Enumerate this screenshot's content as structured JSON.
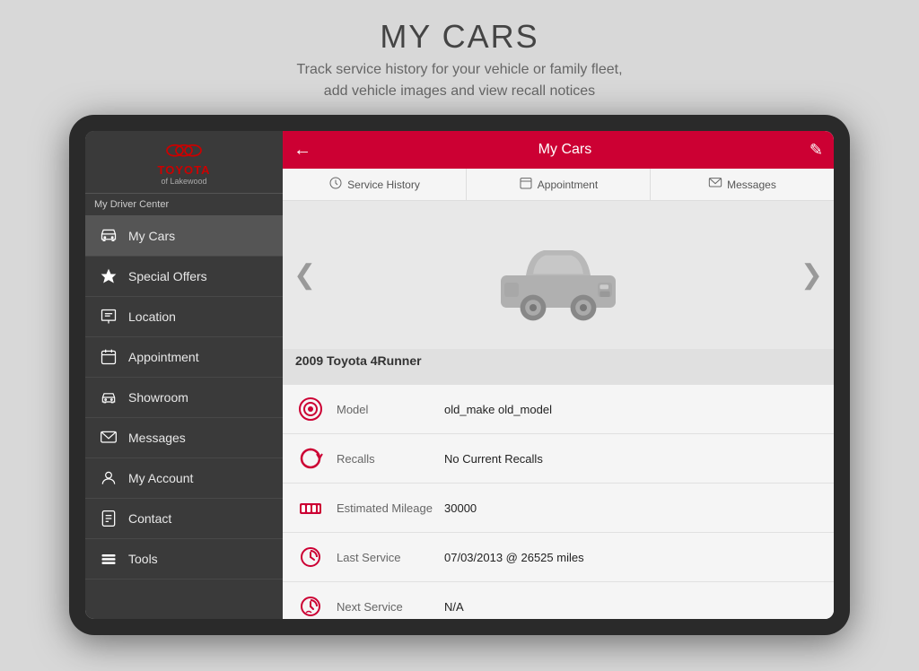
{
  "header": {
    "title": "MY CARS",
    "subtitle_line1": "Track service history for your vehicle or family fleet,",
    "subtitle_line2": "add vehicle images and view recall notices"
  },
  "sidebar": {
    "logo_text": "TOYOTA",
    "logo_sub": "of Lakewood",
    "driver_center": "My Driver Center",
    "items": [
      {
        "id": "my-cars",
        "label": "My Cars",
        "icon": "🏠",
        "active": true
      },
      {
        "id": "special-offers",
        "label": "Special Offers",
        "icon": "⭐",
        "active": false
      },
      {
        "id": "location",
        "label": "Location",
        "icon": "🗺",
        "active": false
      },
      {
        "id": "appointment",
        "label": "Appointment",
        "icon": "📅",
        "active": false
      },
      {
        "id": "showroom",
        "label": "Showroom",
        "icon": "🚗",
        "active": false
      },
      {
        "id": "messages",
        "label": "Messages",
        "icon": "✉",
        "active": false
      },
      {
        "id": "my-account",
        "label": "My Account",
        "icon": "👤",
        "active": false
      },
      {
        "id": "contact",
        "label": "Contact",
        "icon": "📋",
        "active": false
      },
      {
        "id": "tools",
        "label": "Tools",
        "icon": "🔧",
        "active": false
      }
    ]
  },
  "topbar": {
    "title": "My Cars",
    "back_label": "←",
    "edit_label": "✎"
  },
  "tabs": [
    {
      "id": "service-history",
      "label": "Service History",
      "icon": "⚙"
    },
    {
      "id": "appointment",
      "label": "Appointment",
      "icon": "📅"
    },
    {
      "id": "messages",
      "label": "Messages",
      "icon": "✉"
    }
  ],
  "car": {
    "name": "2009 Toyota 4Runner"
  },
  "details": [
    {
      "id": "model",
      "label": "Model",
      "value": "old_make old_model"
    },
    {
      "id": "recalls",
      "label": "Recalls",
      "value": "No Current Recalls"
    },
    {
      "id": "mileage",
      "label": "Estimated Mileage",
      "value": "30000"
    },
    {
      "id": "last-service",
      "label": "Last Service",
      "value": "07/03/2013 @ 26525 miles"
    },
    {
      "id": "next-service",
      "label": "Next Service",
      "value": "N/A"
    }
  ],
  "arrows": {
    "left": "❮",
    "right": "❯"
  }
}
